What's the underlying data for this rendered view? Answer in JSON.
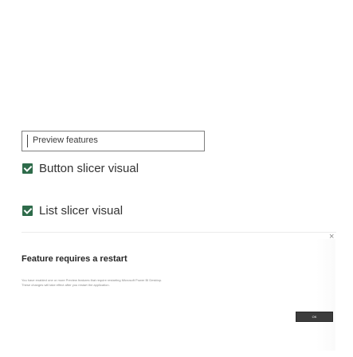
{
  "preview_feature": {
    "label": "Preview features"
  },
  "options": [
    {
      "label": "Button slicer visual",
      "checked": true
    },
    {
      "label": "List slicer visual",
      "checked": true
    }
  ],
  "dialog": {
    "title": "Feature requires a restart",
    "body_line1": "You have enabled one or more Preview features that require restarting Microsoft Power BI Desktop.",
    "body_line2": "These changes will take effect after you restart the application.",
    "ok_label": "OK",
    "close_glyph": "×"
  },
  "colors": {
    "checkbox": "#2e6b4a",
    "button": "#3c3c3c"
  }
}
